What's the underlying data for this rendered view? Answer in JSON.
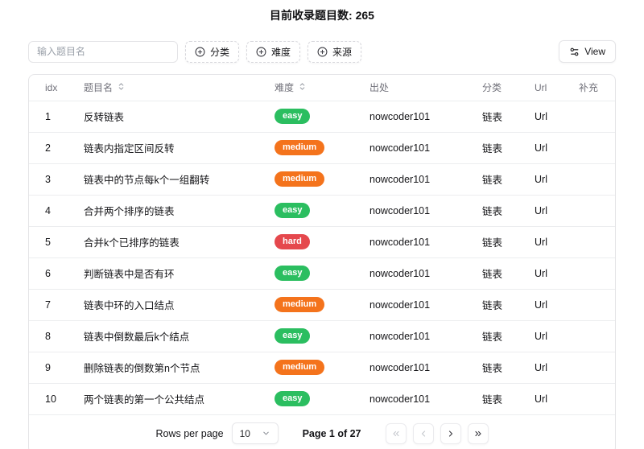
{
  "page": {
    "title_label": "目前收录题目数:",
    "title_count": "265"
  },
  "toolbar": {
    "search_placeholder": "输入题目名",
    "filters": [
      {
        "label": "分类"
      },
      {
        "label": "难度"
      },
      {
        "label": "来源"
      }
    ],
    "view_label": "View"
  },
  "table": {
    "columns": {
      "idx": "idx",
      "name": "题目名",
      "difficulty": "难度",
      "source": "出处",
      "category": "分类",
      "url": "Url",
      "extra": "补充"
    },
    "rows": [
      {
        "idx": "1",
        "name": "反转链表",
        "difficulty": "easy",
        "source": "nowcoder101",
        "category": "链表",
        "url": "Url",
        "extra": ""
      },
      {
        "idx": "2",
        "name": "链表内指定区间反转",
        "difficulty": "medium",
        "source": "nowcoder101",
        "category": "链表",
        "url": "Url",
        "extra": ""
      },
      {
        "idx": "3",
        "name": "链表中的节点每k个一组翻转",
        "difficulty": "medium",
        "source": "nowcoder101",
        "category": "链表",
        "url": "Url",
        "extra": ""
      },
      {
        "idx": "4",
        "name": "合并两个排序的链表",
        "difficulty": "easy",
        "source": "nowcoder101",
        "category": "链表",
        "url": "Url",
        "extra": ""
      },
      {
        "idx": "5",
        "name": "合并k个已排序的链表",
        "difficulty": "hard",
        "source": "nowcoder101",
        "category": "链表",
        "url": "Url",
        "extra": ""
      },
      {
        "idx": "6",
        "name": "判断链表中是否有环",
        "difficulty": "easy",
        "source": "nowcoder101",
        "category": "链表",
        "url": "Url",
        "extra": ""
      },
      {
        "idx": "7",
        "name": "链表中环的入口结点",
        "difficulty": "medium",
        "source": "nowcoder101",
        "category": "链表",
        "url": "Url",
        "extra": ""
      },
      {
        "idx": "8",
        "name": "链表中倒数最后k个结点",
        "difficulty": "easy",
        "source": "nowcoder101",
        "category": "链表",
        "url": "Url",
        "extra": ""
      },
      {
        "idx": "9",
        "name": "删除链表的倒数第n个节点",
        "difficulty": "medium",
        "source": "nowcoder101",
        "category": "链表",
        "url": "Url",
        "extra": ""
      },
      {
        "idx": "10",
        "name": "两个链表的第一个公共结点",
        "difficulty": "easy",
        "source": "nowcoder101",
        "category": "链表",
        "url": "Url",
        "extra": ""
      }
    ]
  },
  "pagination": {
    "rows_per_page_label": "Rows per page",
    "rows_per_page_value": "10",
    "page_info": "Page 1 of 27"
  },
  "colors": {
    "easy": "#2bbe60",
    "medium": "#f4731c",
    "hard": "#e5484d"
  }
}
